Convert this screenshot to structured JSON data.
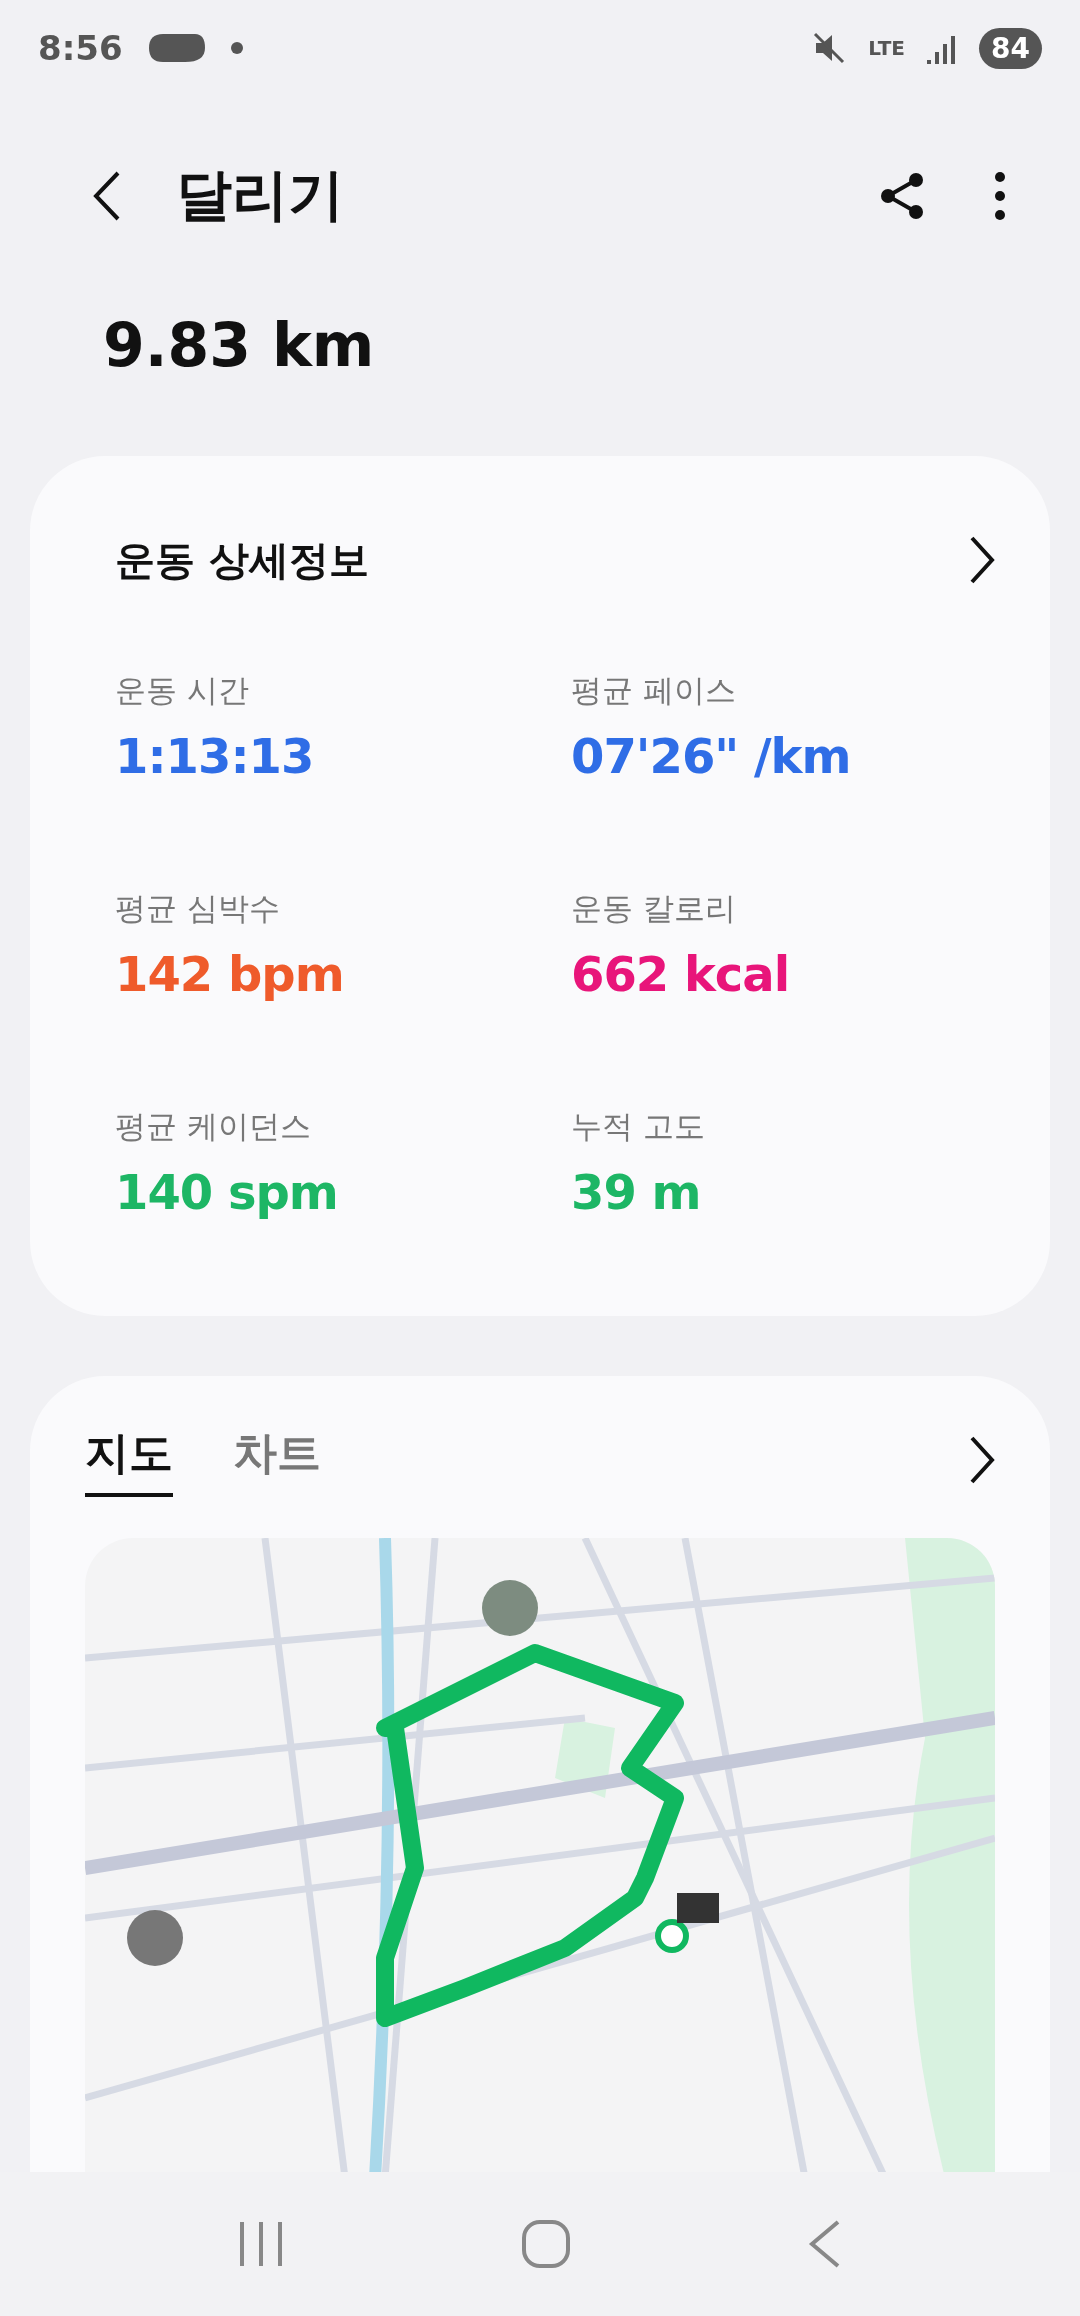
{
  "status_bar": {
    "time": "8:56",
    "network": "LTE",
    "battery": "84"
  },
  "header": {
    "title": "달리기"
  },
  "distance": "9.83 km",
  "details": {
    "title": "운동 상세정보",
    "stats": [
      {
        "label": "운동 시간",
        "value": "1:13:13",
        "color": "#2f6de6"
      },
      {
        "label": "평균 페이스",
        "value": "07'26\" /km",
        "color": "#2f6de6"
      },
      {
        "label": "평균 심박수",
        "value": "142 bpm",
        "color": "#ef5b2b"
      },
      {
        "label": "운동 칼로리",
        "value": "662 kcal",
        "color": "#e8157a"
      },
      {
        "label": "평균 케이던스",
        "value": "140 spm",
        "color": "#1db665"
      },
      {
        "label": "누적 고도",
        "value": "39 m",
        "color": "#1db665"
      }
    ]
  },
  "map_card": {
    "tabs": [
      {
        "label": "지도",
        "selected": true
      },
      {
        "label": "차트",
        "selected": false
      }
    ]
  }
}
